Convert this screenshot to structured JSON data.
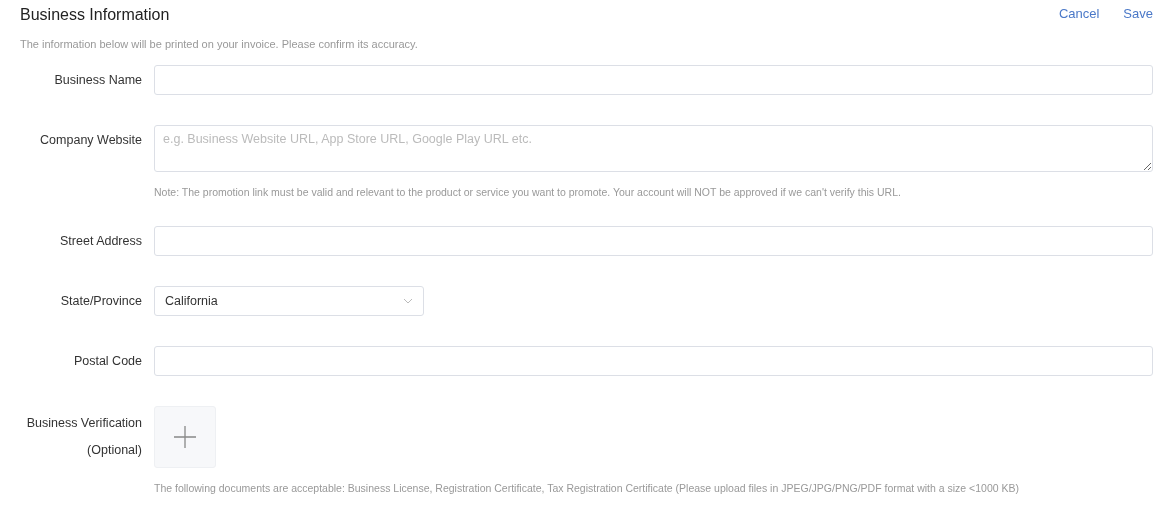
{
  "header": {
    "title": "Business Information",
    "subtitle": "The information below will be printed on your invoice. Please confirm its accuracy.",
    "actions": [
      "Cancel",
      "Save"
    ]
  },
  "fields": [
    {
      "kind": "text",
      "label": "Business Name"
    },
    {
      "kind": "textarea",
      "label": "Company Website",
      "placeholder": "e.g. Business Website URL, App Store URL, Google Play URL etc.",
      "note": "Note: The promotion link must be valid and relevant to the product or service you want to promote. Your account will NOT be approved if we can't verify this URL."
    },
    {
      "kind": "text",
      "label": "Street Address"
    },
    {
      "kind": "select",
      "label": "State/Province",
      "value": "California"
    },
    {
      "kind": "text",
      "label": "Postal Code"
    },
    {
      "kind": "upload",
      "label": "Business Verification (Optional)",
      "note": "The following documents are acceptable: Business License, Registration Certificate, Tax Registration Certificate (Please upload files in JPEG/JPG/PNG/PDF format with a size <1000 KB)"
    }
  ]
}
